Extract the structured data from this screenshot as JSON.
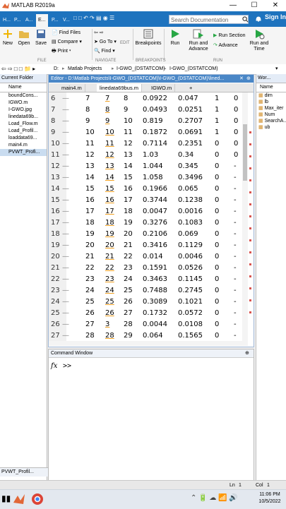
{
  "app": {
    "title": "MATLAB R2019a"
  },
  "toolstrip": {
    "tabs": [
      "H...",
      "P...",
      "A...",
      "E...",
      "P...",
      "V..."
    ],
    "search_placeholder": "Search Documentation",
    "sign_in": "Sign In"
  },
  "ribbon": {
    "new": "New",
    "open": "Open",
    "save": "Save",
    "find_files": "Find Files",
    "compare": "Compare",
    "print": "Print",
    "goto": "Go To",
    "find": "Find",
    "edit": "EDIT",
    "breakpoints": "Breakpoints",
    "run": "Run",
    "run_advance": "Run and Advance",
    "run_section": "Run Section",
    "advance": "Advance",
    "run_time": "Run and Time",
    "labels": {
      "file": "FILE",
      "navigate": "NAVIGATE",
      "breakpoints": "BREAKPOINTS",
      "run": "RUN"
    }
  },
  "address": {
    "path": [
      "D:",
      "Matlab Projects",
      "I-GWO_(DSTATCOM)",
      "I-GWO_(DSTATCOM)"
    ]
  },
  "current_folder": {
    "title": "Current Folder",
    "col_name": "Name",
    "files": [
      "boundCons...",
      "IGWO.m",
      "I-GWO.jpg",
      "linedata69b...",
      "Load_Flow.m",
      "Load_Profil...",
      "loaddata69...",
      "main4.m",
      "PVWT_Profi..."
    ],
    "selected_index": 8,
    "footer": "PVWT_Profil..."
  },
  "editor": {
    "header": "Editor - D:\\Matlab Projects\\I-GWO_(DSTATCOM)\\I-GWO_(DSTATCOM)\\lined...",
    "tabs": [
      "main4.m",
      "linedata69bus.m",
      "IGWO.m",
      "+"
    ],
    "active_tab": 1,
    "rows": [
      [
        "6",
        "7",
        "7",
        "8",
        "0.0922",
        "0.047",
        "1",
        "0"
      ],
      [
        "7",
        "8",
        "8",
        "9",
        "0.0493",
        "0.0251",
        "1",
        "0"
      ],
      [
        "8",
        "9",
        "9",
        "10",
        "0.819",
        "0.2707",
        "1",
        "0"
      ],
      [
        "9",
        "10",
        "10",
        "11",
        "0.1872",
        "0.0691",
        "1",
        "0"
      ],
      [
        "10",
        "11",
        "11",
        "12",
        "0.7114",
        "0.2351",
        "0",
        "0"
      ],
      [
        "11",
        "12",
        "12",
        "13",
        "1.03",
        "0.34",
        "0",
        "0"
      ],
      [
        "12",
        "13",
        "13",
        "14",
        "1.044",
        "0.345",
        "0",
        "-"
      ],
      [
        "13",
        "14",
        "14",
        "15",
        "1.058",
        "0.3496",
        "0",
        "-"
      ],
      [
        "14",
        "15",
        "15",
        "16",
        "0.1966",
        "0.065",
        "0",
        "-"
      ],
      [
        "15",
        "16",
        "16",
        "17",
        "0.3744",
        "0.1238",
        "0",
        "-"
      ],
      [
        "16",
        "17",
        "17",
        "18",
        "0.0047",
        "0.0016",
        "0",
        "-"
      ],
      [
        "17",
        "18",
        "18",
        "19",
        "0.3276",
        "0.1083",
        "0",
        "-"
      ],
      [
        "18",
        "19",
        "19",
        "20",
        "0.2106",
        "0.069",
        "0",
        "-"
      ],
      [
        "19",
        "20",
        "20",
        "21",
        "0.3416",
        "0.1129",
        "0",
        "-"
      ],
      [
        "20",
        "21",
        "21",
        "22",
        "0.014",
        "0.0046",
        "0",
        "-"
      ],
      [
        "21",
        "22",
        "22",
        "23",
        "0.1591",
        "0.0526",
        "0",
        "-"
      ],
      [
        "22",
        "23",
        "23",
        "24",
        "0.3463",
        "0.1145",
        "0",
        "-"
      ],
      [
        "23",
        "24",
        "24",
        "25",
        "0.7488",
        "0.2745",
        "0",
        "-"
      ],
      [
        "24",
        "25",
        "25",
        "26",
        "0.3089",
        "0.1021",
        "0",
        "-"
      ],
      [
        "25",
        "26",
        "26",
        "27",
        "0.1732",
        "0.0572",
        "0",
        "-"
      ],
      [
        "26",
        "27",
        "3",
        "28",
        "0.0044",
        "0.0108",
        "0",
        "-"
      ],
      [
        "27",
        "28",
        "28",
        "29",
        "0.064",
        "0.1565",
        "0",
        "-"
      ]
    ]
  },
  "command_window": {
    "title": "Command Window",
    "fx": "fx",
    "prompt": ">>"
  },
  "workspace": {
    "title": "Wor...",
    "col_name": "Name",
    "vars": [
      "dim",
      "lb",
      "Max_iter",
      "Num",
      "SearchA...",
      "ub"
    ]
  },
  "status": {
    "ln": "Ln",
    "ln_val": "1",
    "col": "Col",
    "col_val": "1"
  },
  "taskbar": {
    "time": "11:06 PM",
    "date": "10/5/2022"
  },
  "colors": {
    "accent": "#1e73be",
    "editor_header": "#4a87c7",
    "selection": "#c9dcf0"
  }
}
